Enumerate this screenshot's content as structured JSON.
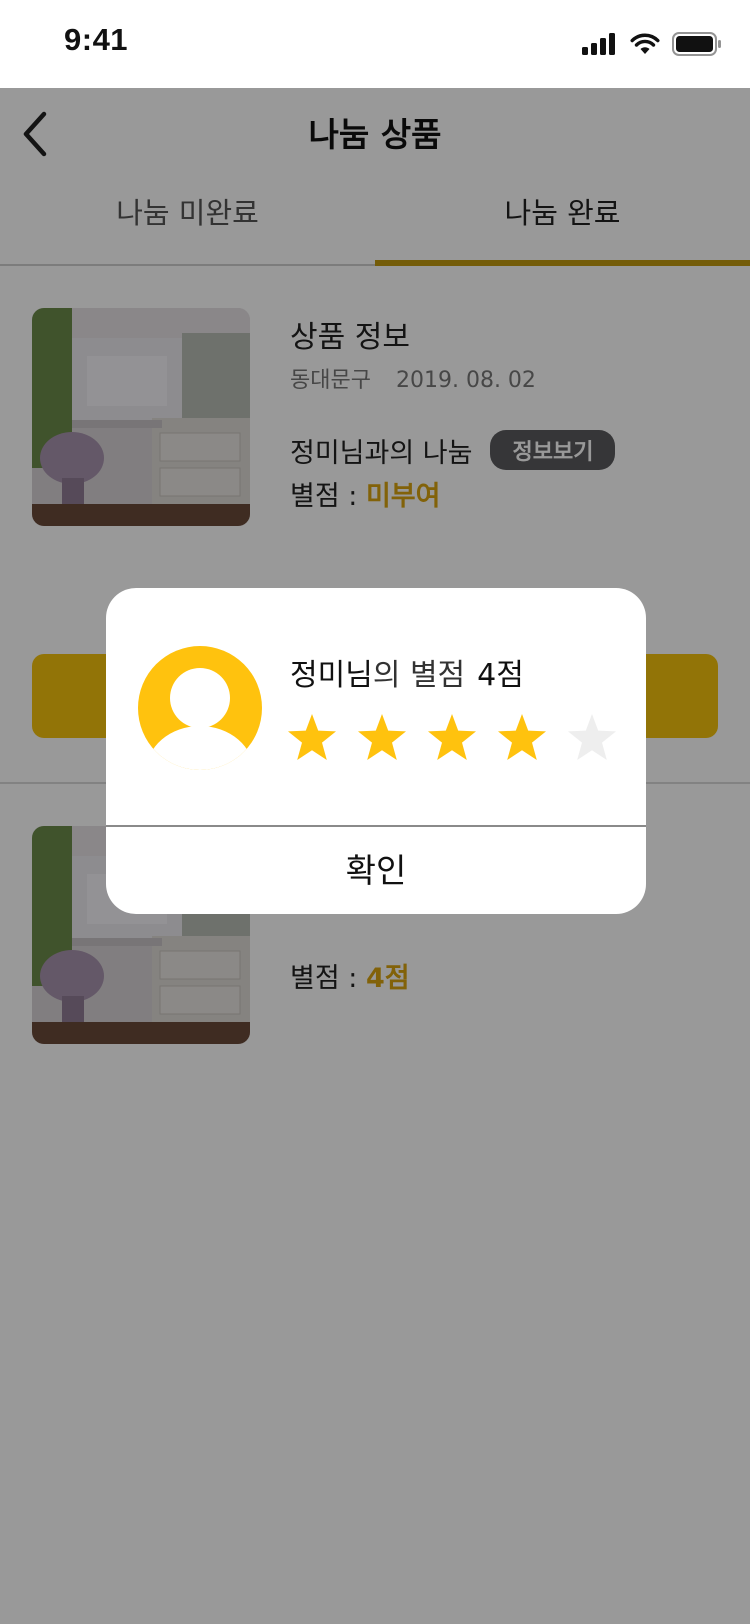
{
  "status": {
    "time": "9:41"
  },
  "header": {
    "title": "나눔 상품"
  },
  "tabs": [
    {
      "label": "나눔 미완료",
      "active": false
    },
    {
      "label": "나눔 완료",
      "active": true
    }
  ],
  "items": [
    {
      "title": "상품 정보",
      "district": "동대문구",
      "date": "2019. 08. 02",
      "partner_text": "정미님과의 나눔",
      "info_button": "정보보기",
      "rating_label": "별점 : ",
      "rating_value": "미부여"
    },
    {
      "rating_label": "별점 : ",
      "rating_value": "4점"
    }
  ],
  "dialog": {
    "name": "정미님",
    "name_suffix": "의 별점",
    "score_text": "4점",
    "rating": 4,
    "max_rating": 5,
    "confirm_label": "확인"
  },
  "colors": {
    "accent": "#f4c20d",
    "tab_underline": "#c29a10",
    "rating_text": "#d9a410",
    "info_button_bg": "#5b5b5e",
    "star_filled": "#ffc20e",
    "star_empty": "#eeeeee",
    "avatar_bg": "#ffc20e",
    "overlay": "rgba(0,0,0,0.40)"
  },
  "icons": {
    "back": "chevron-left-icon",
    "signal": "cellular-signal-icon",
    "wifi": "wifi-icon",
    "battery": "battery-icon",
    "avatar": "user-avatar-icon",
    "star": "star-icon"
  }
}
